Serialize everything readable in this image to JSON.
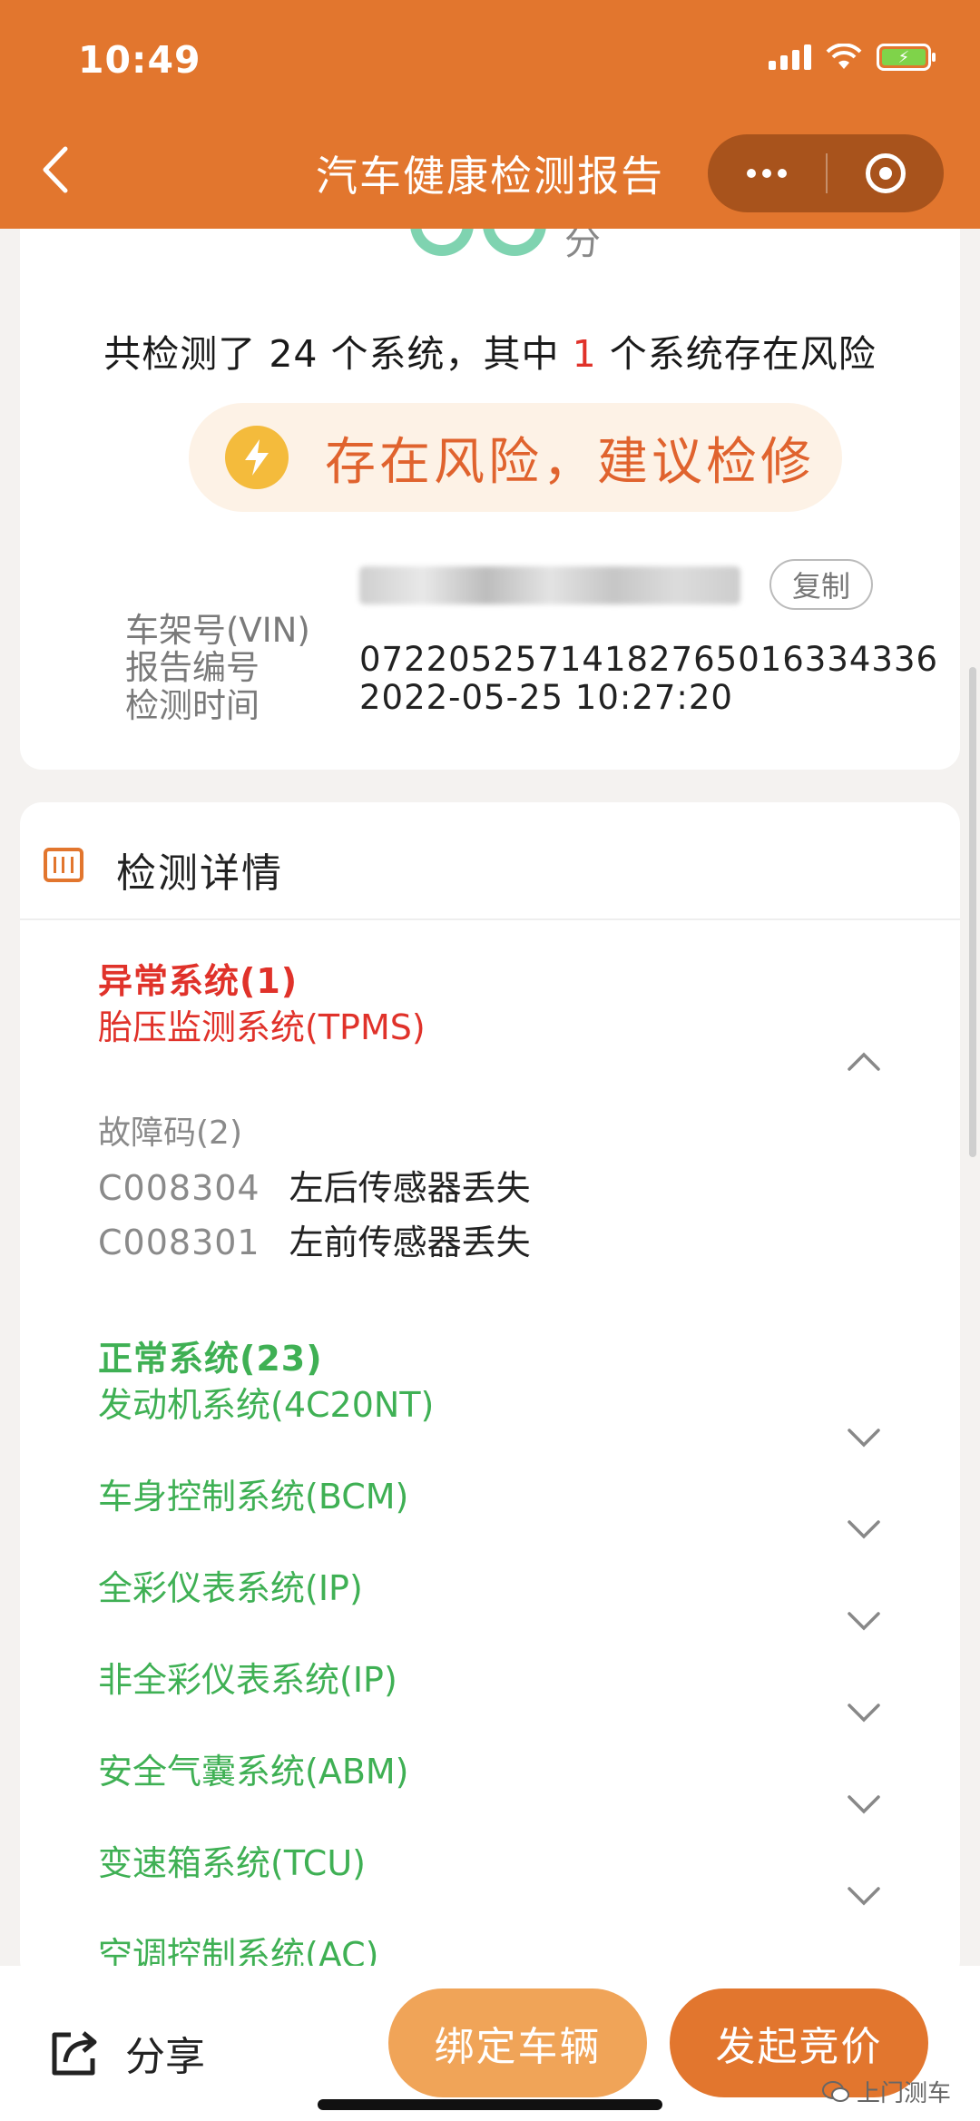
{
  "status_bar": {
    "time": "10:49"
  },
  "nav": {
    "title": "汽车健康检测报告"
  },
  "score": {
    "unit": "分"
  },
  "summary": {
    "prefix": "共检测了 ",
    "total": "24",
    "middle": " 个系统，其中 ",
    "risk_count": "1",
    "suffix": " 个系统存在风险"
  },
  "risk_banner": {
    "text": "存在风险，建议检修"
  },
  "info": {
    "vin_label": "车架号(VIN)",
    "copy_label": "复制",
    "report_label": "报告编号",
    "report_value": "07220525714182765016334336",
    "time_label": "检测时间",
    "time_value": "2022-05-25 10:27:20"
  },
  "detail": {
    "title": "检测详情",
    "abnormal_title": "异常系统(1)",
    "abnormal_system": "胎压监测系统(TPMS)",
    "fault_title": "故障码(2)",
    "faults": [
      {
        "code": "C008304",
        "desc": "左后传感器丢失"
      },
      {
        "code": "C008301",
        "desc": "左前传感器丢失"
      }
    ],
    "normal_title": "正常系统(23)",
    "normal_systems": [
      "发动机系统(4C20NT)",
      "车身控制系统(BCM)",
      "全彩仪表系统(IP)",
      "非全彩仪表系统(IP)",
      "安全气囊系统(ABM)",
      "变速箱系统(TCU)",
      "空调控制系统(AC)"
    ]
  },
  "bottom": {
    "share": "分享",
    "bind": "绑定车辆",
    "bid": "发起竞价",
    "source": "上门测车"
  },
  "colors": {
    "brand": "#e2762e",
    "risk_red": "#e0322a",
    "normal_green": "#3fb054"
  }
}
